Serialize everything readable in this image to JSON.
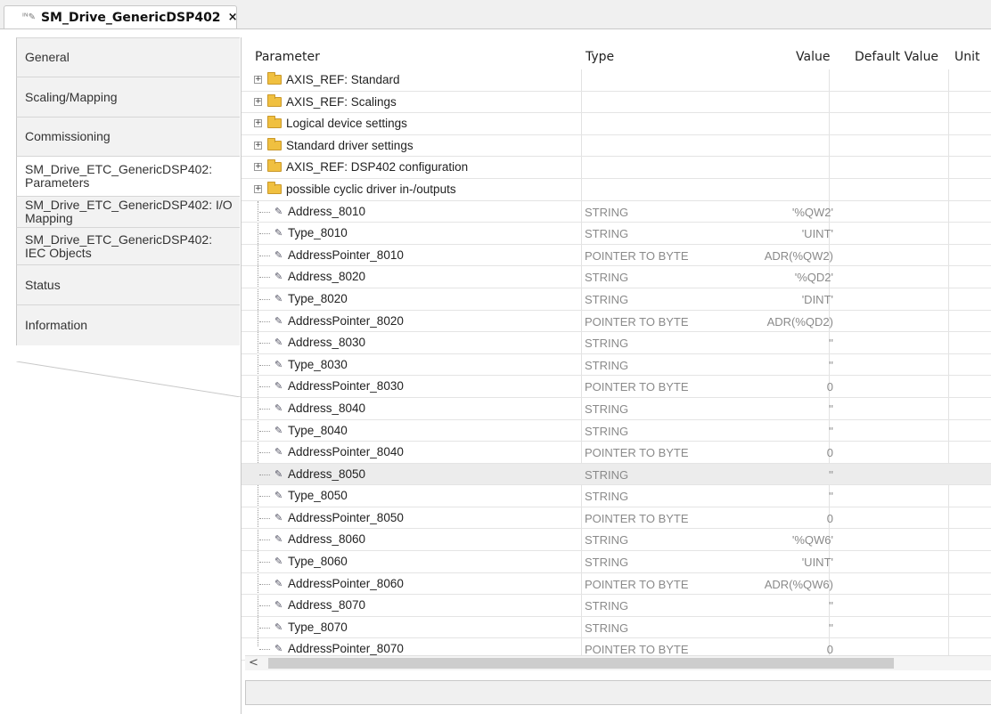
{
  "document_tab": {
    "icon": "ᴵᴺ✎",
    "title": "SM_Drive_GenericDSP402",
    "close": "×"
  },
  "sidebar": {
    "tabs": [
      {
        "label": "General",
        "active": false
      },
      {
        "label": "Scaling/Mapping",
        "active": false
      },
      {
        "label": "Commissioning",
        "active": false
      },
      {
        "label": "SM_Drive_ETC_GenericDSP402: Parameters",
        "active": true
      },
      {
        "label": "SM_Drive_ETC_GenericDSP402: I/O Mapping",
        "active": false
      },
      {
        "label": "SM_Drive_ETC_GenericDSP402: IEC Objects",
        "active": false
      },
      {
        "label": "Status",
        "active": false
      },
      {
        "label": "Information",
        "active": false
      }
    ]
  },
  "grid": {
    "headers": {
      "parameter": "Parameter",
      "type": "Type",
      "value": "Value",
      "default_value": "Default Value",
      "unit": "Unit"
    },
    "groups": [
      "AXIS_REF: Standard",
      "AXIS_REF: Scalings",
      "Logical device settings",
      "Standard driver settings",
      "AXIS_REF: DSP402 configuration",
      "possible cyclic driver in-/outputs"
    ],
    "rows": [
      {
        "name": "Address_8010",
        "type": "STRING",
        "value": "'%QW2'"
      },
      {
        "name": "Type_8010",
        "type": "STRING",
        "value": "'UINT'"
      },
      {
        "name": "AddressPointer_8010",
        "type": "POINTER TO BYTE",
        "value": "ADR(%QW2)"
      },
      {
        "name": "Address_8020",
        "type": "STRING",
        "value": "'%QD2'"
      },
      {
        "name": "Type_8020",
        "type": "STRING",
        "value": "'DINT'"
      },
      {
        "name": "AddressPointer_8020",
        "type": "POINTER TO BYTE",
        "value": "ADR(%QD2)"
      },
      {
        "name": "Address_8030",
        "type": "STRING",
        "value": "''"
      },
      {
        "name": "Type_8030",
        "type": "STRING",
        "value": "''"
      },
      {
        "name": "AddressPointer_8030",
        "type": "POINTER TO BYTE",
        "value": "0"
      },
      {
        "name": "Address_8040",
        "type": "STRING",
        "value": "''"
      },
      {
        "name": "Type_8040",
        "type": "STRING",
        "value": "''"
      },
      {
        "name": "AddressPointer_8040",
        "type": "POINTER TO BYTE",
        "value": "0"
      },
      {
        "name": "Address_8050",
        "type": "STRING",
        "value": "''",
        "highlight": true
      },
      {
        "name": "Type_8050",
        "type": "STRING",
        "value": "''"
      },
      {
        "name": "AddressPointer_8050",
        "type": "POINTER TO BYTE",
        "value": "0"
      },
      {
        "name": "Address_8060",
        "type": "STRING",
        "value": "'%QW6'"
      },
      {
        "name": "Type_8060",
        "type": "STRING",
        "value": "'UINT'"
      },
      {
        "name": "AddressPointer_8060",
        "type": "POINTER TO BYTE",
        "value": "ADR(%QW6)"
      },
      {
        "name": "Address_8070",
        "type": "STRING",
        "value": "''"
      },
      {
        "name": "Type_8070",
        "type": "STRING",
        "value": "''"
      },
      {
        "name": "AddressPointer_8070",
        "type": "POINTER TO BYTE",
        "value": "0"
      }
    ]
  },
  "scrollbar": {
    "left_arrow": "<"
  }
}
